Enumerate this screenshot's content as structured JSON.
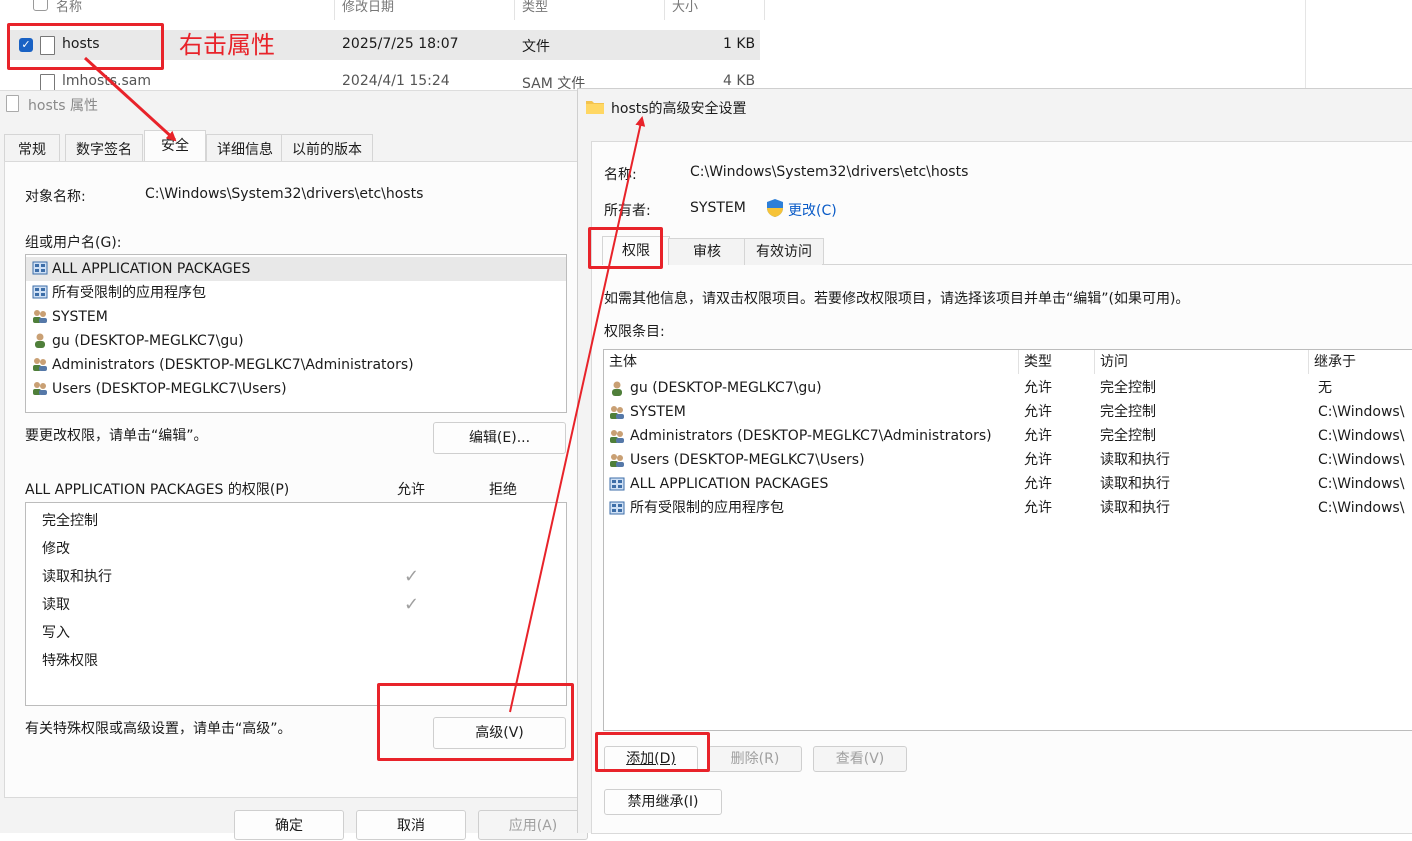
{
  "explorer": {
    "columns": [
      "名称",
      "修改日期",
      "类型",
      "大小"
    ],
    "rows": [
      {
        "name": "hosts",
        "date": "2025/7/25 18:07",
        "type": "文件",
        "size": "1 KB",
        "selected": true
      },
      {
        "name": "lmhosts.sam",
        "date": "2024/4/1 15:24",
        "type": "SAM 文件",
        "size": "4 KB",
        "selected": false
      }
    ]
  },
  "annotation": {
    "right_click": "右击属性"
  },
  "props": {
    "title": "hosts 属性",
    "tabs": [
      "常规",
      "数字签名",
      "安全",
      "详细信息",
      "以前的版本"
    ],
    "object_label": "对象名称:",
    "object_value": "C:\\Windows\\System32\\drivers\\etc\\hosts",
    "groups_label": "组或用户名(G):",
    "groups": [
      {
        "name": "ALL APPLICATION PACKAGES",
        "icon": "package-icon"
      },
      {
        "name": "所有受限制的应用程序包",
        "icon": "package-icon"
      },
      {
        "name": "SYSTEM",
        "icon": "group-icon"
      },
      {
        "name": "gu (DESKTOP-MEGLKC7\\gu)",
        "icon": "user-icon"
      },
      {
        "name": "Administrators (DESKTOP-MEGLKC7\\Administrators)",
        "icon": "group-icon"
      },
      {
        "name": "Users (DESKTOP-MEGLKC7\\Users)",
        "icon": "group-icon"
      }
    ],
    "change_hint": "要更改权限，请单击“编辑”。",
    "edit_button": "编辑(E)...",
    "perm_header": "ALL APPLICATION PACKAGES 的权限(P)",
    "allow_col": "允许",
    "deny_col": "拒绝",
    "perms": [
      {
        "name": "完全控制",
        "allow": false
      },
      {
        "name": "修改",
        "allow": false
      },
      {
        "name": "读取和执行",
        "allow": true
      },
      {
        "name": "读取",
        "allow": true
      },
      {
        "name": "写入",
        "allow": false
      },
      {
        "name": "特殊权限",
        "allow": false
      }
    ],
    "adv_hint": "有关特殊权限或高级设置，请单击“高级”。",
    "advanced_button": "高级(V)",
    "ok_button": "确定",
    "cancel_button": "取消",
    "apply_button": "应用(A)"
  },
  "advanced": {
    "title": "hosts的高级安全设置",
    "name_label": "名称:",
    "name_value": "C:\\Windows\\System32\\drivers\\etc\\hosts",
    "owner_label": "所有者:",
    "owner_value": "SYSTEM",
    "change_link": "更改(C)",
    "tabs": [
      "权限",
      "审核",
      "有效访问"
    ],
    "info": "如需其他信息，请双击权限项目。若要修改权限项目，请选择该项目并单击“编辑”(如果可用)。",
    "entries_label": "权限条目:",
    "columns": [
      "主体",
      "类型",
      "访问",
      "继承于"
    ],
    "entries": [
      {
        "principal": "gu (DESKTOP-MEGLKC7\\gu)",
        "type": "允许",
        "access": "完全控制",
        "inherit": "无",
        "icon": "user-icon"
      },
      {
        "principal": "SYSTEM",
        "type": "允许",
        "access": "完全控制",
        "inherit": "C:\\Windows\\",
        "icon": "group-icon"
      },
      {
        "principal": "Administrators (DESKTOP-MEGLKC7\\Administrators)",
        "type": "允许",
        "access": "完全控制",
        "inherit": "C:\\Windows\\",
        "icon": "group-icon"
      },
      {
        "principal": "Users (DESKTOP-MEGLKC7\\Users)",
        "type": "允许",
        "access": "读取和执行",
        "inherit": "C:\\Windows\\",
        "icon": "group-icon"
      },
      {
        "principal": "ALL APPLICATION PACKAGES",
        "type": "允许",
        "access": "读取和执行",
        "inherit": "C:\\Windows\\",
        "icon": "package-icon"
      },
      {
        "principal": "所有受限制的应用程序包",
        "type": "允许",
        "access": "读取和执行",
        "inherit": "C:\\Windows\\",
        "icon": "package-icon"
      }
    ],
    "add_button": "添加(D)",
    "remove_button": "删除(R)",
    "view_button": "查看(V)",
    "disable_inherit_button": "禁用继承(I)"
  },
  "colors": {
    "annotation_red": "#e8232a",
    "link_blue": "#0a5bc7",
    "check_blue": "#1a62c4"
  }
}
